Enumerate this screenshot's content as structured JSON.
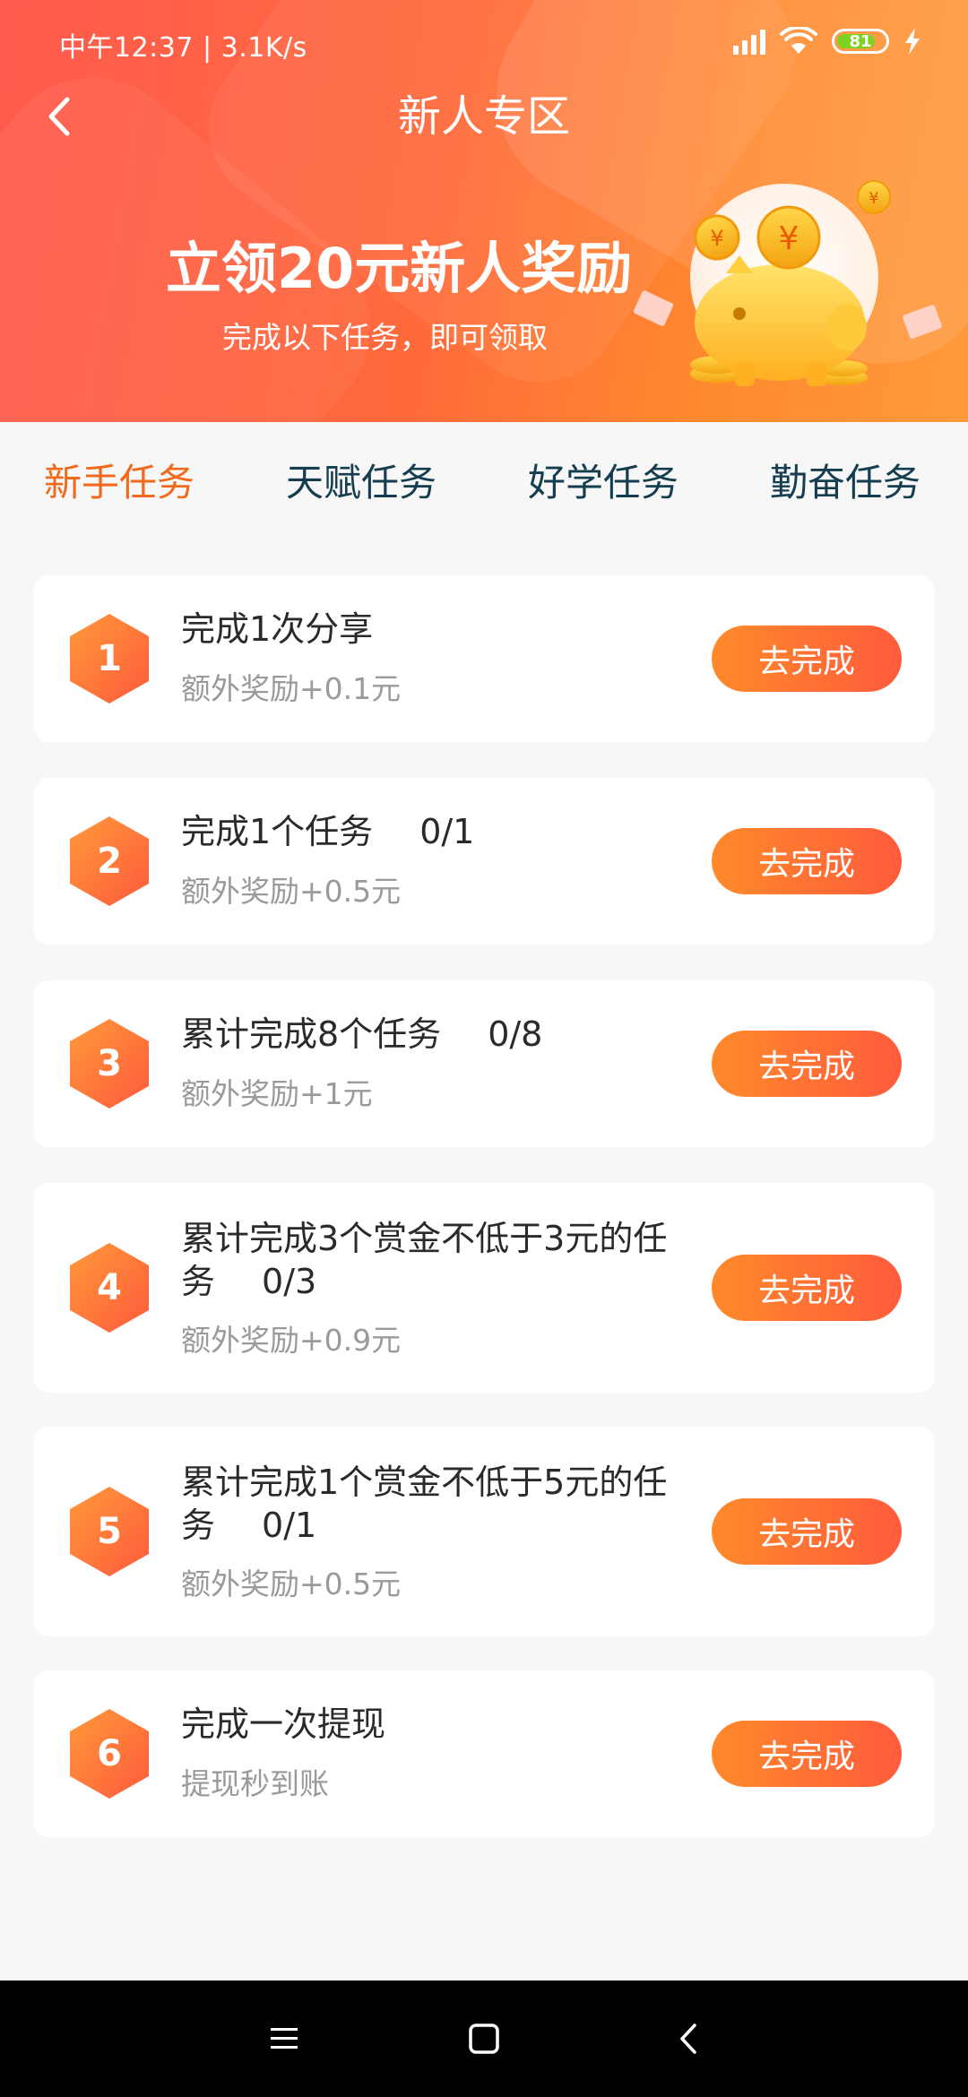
{
  "status_bar": {
    "time_text": "中午12:37 | 3.1K/s",
    "battery": "81",
    "battery_level": 0.81,
    "battery_color": "#7ed321",
    "icons": [
      "signal-icon",
      "wifi-icon",
      "battery-icon",
      "charging-icon"
    ]
  },
  "header": {
    "back_icon": "chevron-left-icon",
    "title": "新人专区"
  },
  "banner": {
    "title": "立领20元新人奖励",
    "subtitle": "完成以下任务，即可领取",
    "illustration": "piggy-bank-coins",
    "gradient": [
      "#ff5a4e",
      "#ff9a3c"
    ]
  },
  "tabs": [
    {
      "label": "新手任务",
      "active": true
    },
    {
      "label": "天赋任务",
      "active": false
    },
    {
      "label": "好学任务",
      "active": false
    },
    {
      "label": "勤奋任务",
      "active": false
    }
  ],
  "tasks": [
    {
      "number": "1",
      "title": "完成1次分享",
      "progress": "",
      "subtitle": "额外奖励+0.1元",
      "button": "去完成"
    },
    {
      "number": "2",
      "title": "完成1个任务",
      "progress": "0/1",
      "subtitle": "额外奖励+0.5元",
      "button": "去完成"
    },
    {
      "number": "3",
      "title": "累计完成8个任务",
      "progress": "0/8",
      "subtitle": "额外奖励+1元",
      "button": "去完成"
    },
    {
      "number": "4",
      "title": "累计完成3个赏金不低于3元的任务",
      "progress": "0/3",
      "subtitle": "额外奖励+0.9元",
      "button": "去完成"
    },
    {
      "number": "5",
      "title": "累计完成1个赏金不低于5元的任务",
      "progress": "0/1",
      "subtitle": "额外奖励+0.5元",
      "button": "去完成"
    },
    {
      "number": "6",
      "title": "完成一次提现",
      "progress": "",
      "subtitle": "提现秒到账",
      "button": "去完成"
    }
  ],
  "colors": {
    "accent": "#f06a1e",
    "tab_text": "#143d4f",
    "button_gradient": [
      "#ff8a2a",
      "#ff5b3c"
    ],
    "badge_gradient": [
      "#ff9a3a",
      "#ff5a3c"
    ]
  },
  "nav_bar": {
    "icons": [
      "menu-icon",
      "home-square-icon",
      "back-triangle-icon"
    ]
  }
}
